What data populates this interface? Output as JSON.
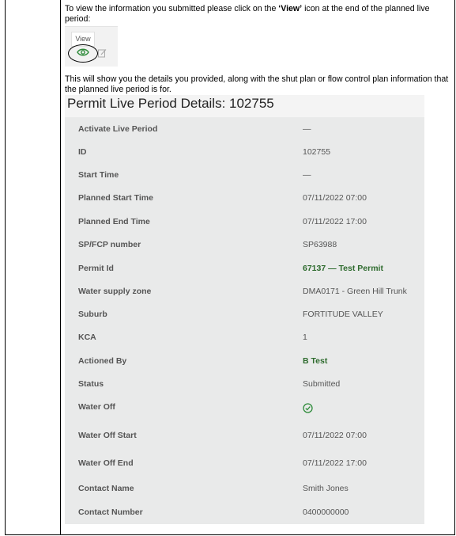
{
  "intro": {
    "before": "To view the information you submitted please click on the ",
    "bold": "‘View’",
    "after": " icon at the end of the planned live period:"
  },
  "tooltip": "View",
  "mid_text": "This will show you the details you provided, along with the shut plan or flow control plan information that the planned live period is for.",
  "panel": {
    "title": "Permit Live Period Details: 102755",
    "rows": [
      {
        "label": "Activate Live Period",
        "value": "—"
      },
      {
        "label": "ID",
        "value": "102755"
      },
      {
        "label": "Start Time",
        "value": "—"
      },
      {
        "label": "Planned Start Time",
        "value": "07/11/2022 07:00"
      },
      {
        "label": "Planned End Time",
        "value": "07/11/2022 17:00"
      },
      {
        "label": "SP/FCP number",
        "value": "SP63988"
      },
      {
        "label": "Permit Id",
        "value": "67137 — Test Permit"
      },
      {
        "label": "Water supply zone",
        "value": "DMA0171 - Green Hill Trunk"
      },
      {
        "label": "Suburb",
        "value": "FORTITUDE VALLEY"
      },
      {
        "label": "KCA",
        "value": "1"
      },
      {
        "label": "Actioned By",
        "value": "B Test"
      },
      {
        "label": "Status",
        "value": "Submitted"
      },
      {
        "label": "Water Off",
        "value": ""
      },
      {
        "label": "Water Off Start",
        "value": "07/11/2022 07:00"
      },
      {
        "label": "Water Off End",
        "value": "07/11/2022 17:00"
      },
      {
        "label": "Contact Name",
        "value": "Smith Jones"
      },
      {
        "label": "Contact Number",
        "value": "0400000000"
      }
    ]
  },
  "icons": {
    "view": "eye-icon",
    "edit": "edit-icon",
    "water_off": "check-circle-icon"
  },
  "colors": {
    "panel_bg": "#e9eaea",
    "link_green": "#2e6b2e",
    "check_green": "#2e8b3a"
  }
}
